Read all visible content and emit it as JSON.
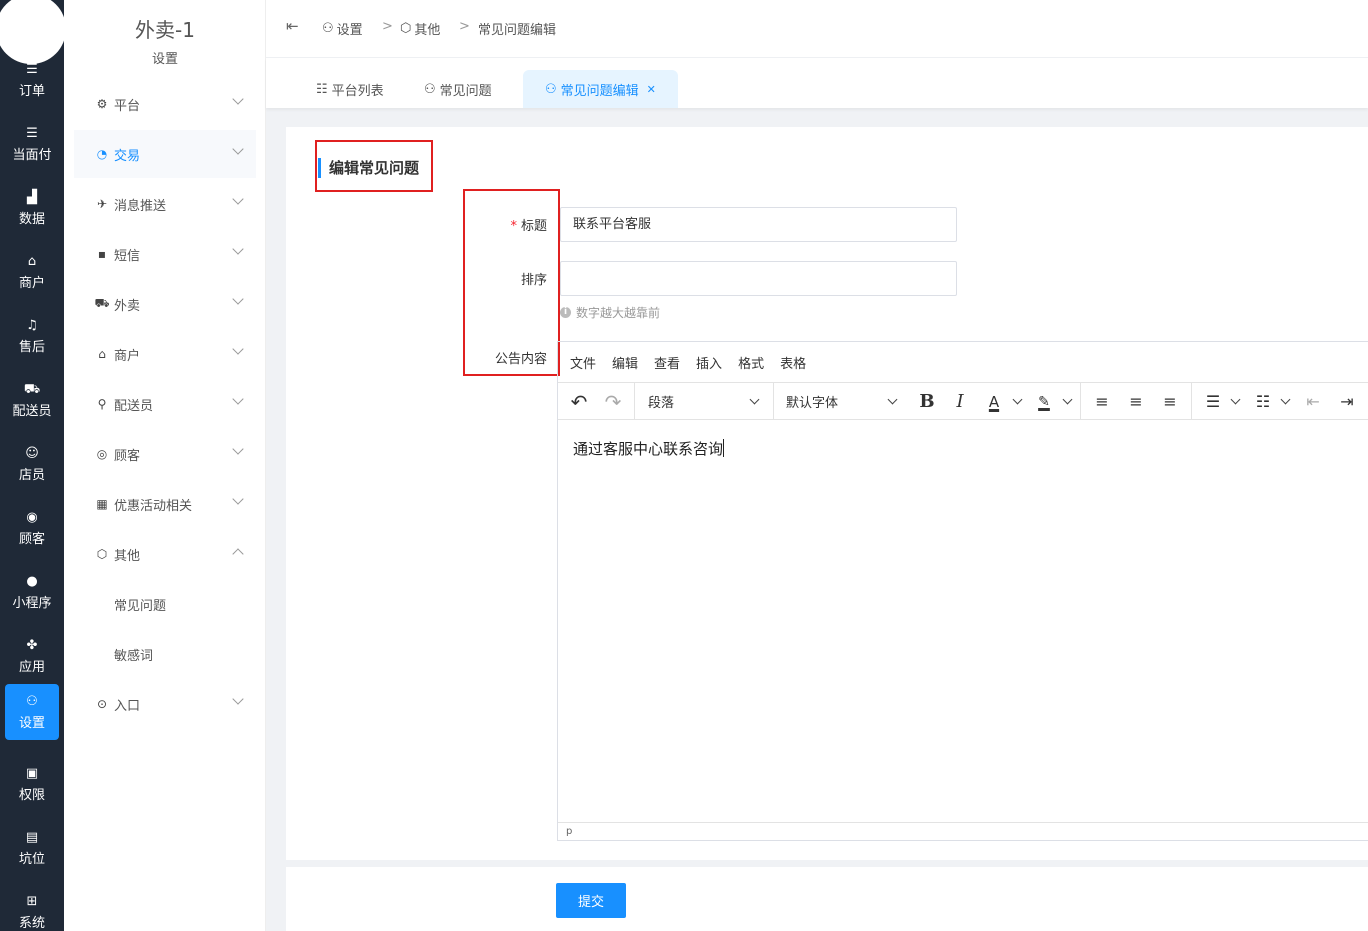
{
  "rail": {
    "items": [
      {
        "label": "订单",
        "icon": "list-icon"
      },
      {
        "label": "当面付",
        "icon": "list-icon"
      },
      {
        "label": "数据",
        "icon": "bar-chart-icon"
      },
      {
        "label": "商户",
        "icon": "store-icon"
      },
      {
        "label": "售后",
        "icon": "headset-icon"
      },
      {
        "label": "配送员",
        "icon": "delivery-icon"
      },
      {
        "label": "店员",
        "icon": "users-icon"
      },
      {
        "label": "顾客",
        "icon": "customer-icon"
      },
      {
        "label": "小程序",
        "icon": "wechat-icon"
      },
      {
        "label": "应用",
        "icon": "apps-icon"
      },
      {
        "label": "设置",
        "icon": "settings-user-icon"
      },
      {
        "label": "权限",
        "icon": "lock-icon"
      },
      {
        "label": "坑位",
        "icon": "report-icon"
      },
      {
        "label": "系统",
        "icon": "windows-icon"
      }
    ],
    "active_index": 10
  },
  "sidebar": {
    "brand": "外卖-1",
    "subtitle": "设置",
    "items": [
      {
        "label": "平台"
      },
      {
        "label": "交易"
      },
      {
        "label": "消息推送"
      },
      {
        "label": "短信"
      },
      {
        "label": "外卖"
      },
      {
        "label": "商户"
      },
      {
        "label": "配送员"
      },
      {
        "label": "顾客"
      },
      {
        "label": "优惠活动相关"
      },
      {
        "label": "其他"
      },
      {
        "label": "常见问题"
      },
      {
        "label": "敏感词"
      },
      {
        "label": "入口"
      }
    ]
  },
  "breadcrumb": {
    "items": [
      "设置",
      "其他",
      "常见问题编辑"
    ],
    "separator": ">"
  },
  "tabs": [
    {
      "label": "平台列表"
    },
    {
      "label": "常见问题"
    },
    {
      "label": "常见问题编辑",
      "active": true
    }
  ],
  "form": {
    "section_title": "编辑常见问题",
    "title_label": "标题",
    "title_required_mark": "*",
    "title_value": "联系平台客服",
    "sort_label": "排序",
    "sort_value": "",
    "sort_hint": "数字越大越靠前",
    "content_label": "公告内容",
    "submit_label": "提交"
  },
  "editor": {
    "menubar": [
      "文件",
      "编辑",
      "查看",
      "插入",
      "格式",
      "表格"
    ],
    "block_format": "段落",
    "font_family": "默认字体",
    "content": "通过客服中心联系咨询",
    "status_path": "p"
  },
  "colors": {
    "accent": "#1890ff",
    "rail_bg": "#1f2937",
    "annotation_red": "#e02020"
  }
}
